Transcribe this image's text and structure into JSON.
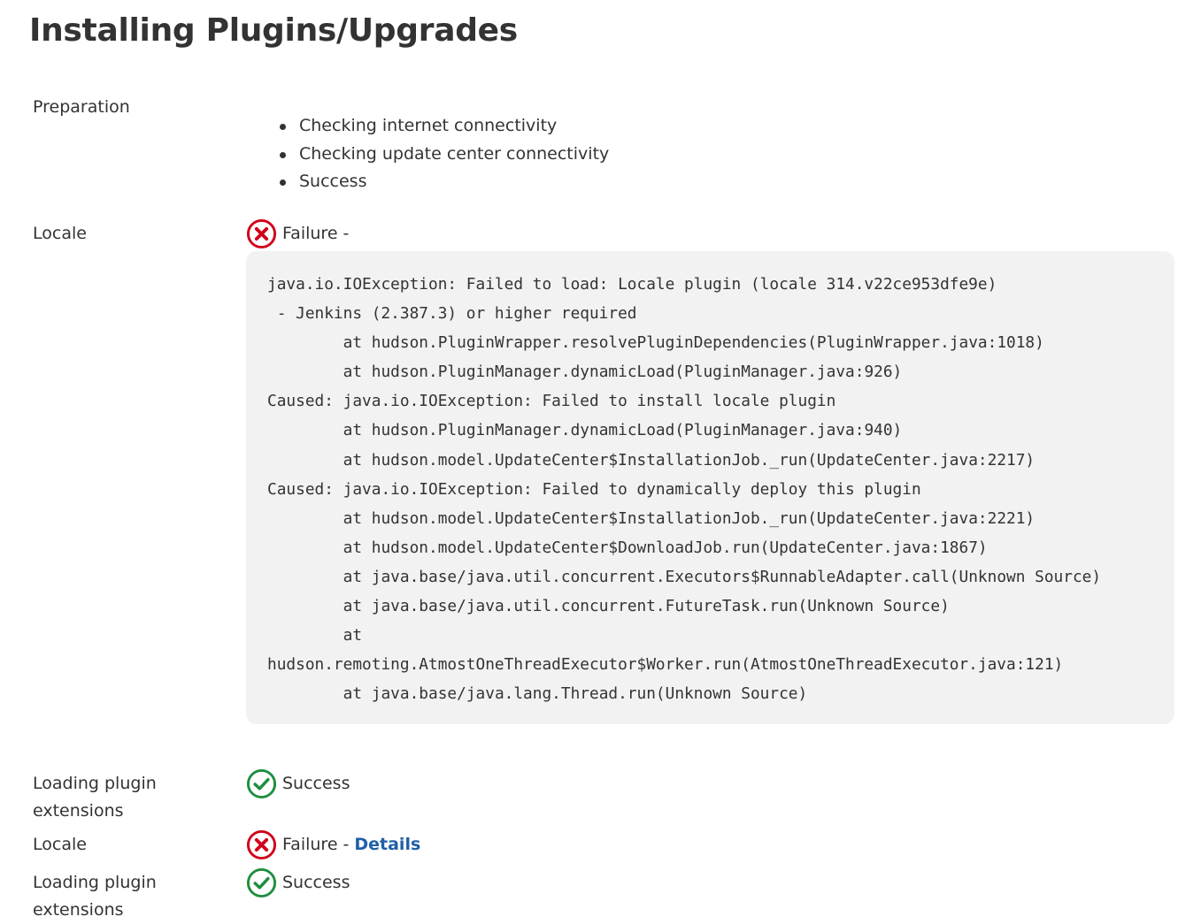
{
  "page": {
    "title": "Installing Plugins/Upgrades"
  },
  "preparation": {
    "label": "Preparation",
    "items": [
      "Checking internet connectivity",
      "Checking update center connectivity",
      "Success"
    ]
  },
  "locale_1": {
    "label": "Locale",
    "status": "Failure",
    "separator": "-",
    "icon": "failure-x-circle-icon",
    "error_text": "java.io.IOException: Failed to load: Locale plugin (locale 314.v22ce953dfe9e)\n - Jenkins (2.387.3) or higher required\n\tat hudson.PluginWrapper.resolvePluginDependencies(PluginWrapper.java:1018)\n\tat hudson.PluginManager.dynamicLoad(PluginManager.java:926)\nCaused: java.io.IOException: Failed to install locale plugin\n\tat hudson.PluginManager.dynamicLoad(PluginManager.java:940)\n\tat hudson.model.UpdateCenter$InstallationJob._run(UpdateCenter.java:2217)\nCaused: java.io.IOException: Failed to dynamically deploy this plugin\n\tat hudson.model.UpdateCenter$InstallationJob._run(UpdateCenter.java:2221)\n\tat hudson.model.UpdateCenter$DownloadJob.run(UpdateCenter.java:1867)\n\tat java.base/java.util.concurrent.Executors$RunnableAdapter.call(Unknown Source)\n\tat java.base/java.util.concurrent.FutureTask.run(Unknown Source)\n\tat\nhudson.remoting.AtmostOneThreadExecutor$Worker.run(AtmostOneThreadExecutor.java:121)\n\tat java.base/java.lang.Thread.run(Unknown Source)"
  },
  "loading_extensions_1": {
    "label": "Loading plugin extensions",
    "status": "Success",
    "icon": "success-check-circle-icon"
  },
  "locale_2": {
    "label": "Locale",
    "status": "Failure",
    "separator": "-",
    "details_link": "Details",
    "icon": "failure-x-circle-icon"
  },
  "loading_extensions_2": {
    "label": "Loading plugin extensions",
    "status": "Success",
    "icon": "success-check-circle-icon"
  },
  "colors": {
    "failure": "#d0021b",
    "success": "#1e8e3e",
    "link": "#1f5fa8",
    "code_bg": "#f2f2f2"
  }
}
